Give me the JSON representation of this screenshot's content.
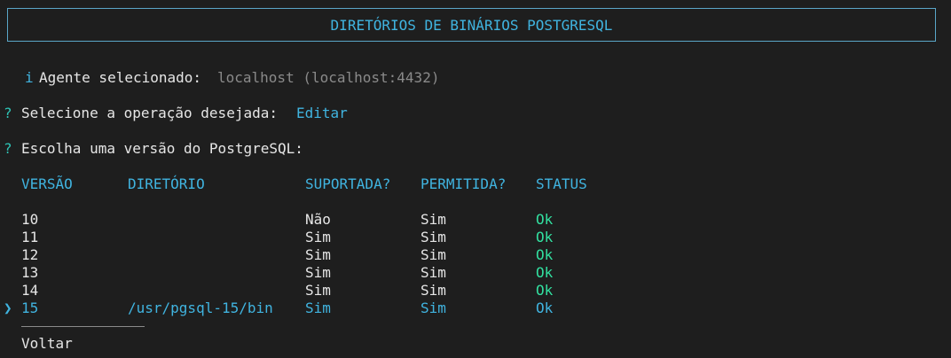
{
  "header": {
    "title": "DIRETÓRIOS DE BINÁRIOS POSTGRESQL"
  },
  "agent": {
    "icon": "i",
    "label": "Agente selecionado:",
    "value": "localhost (localhost:4432)"
  },
  "operation": {
    "prefix": "?",
    "label": "Selecione a operação desejada:",
    "value": "Editar"
  },
  "version_prompt": {
    "prefix": "?",
    "label": "Escolha uma versão do PostgreSQL:"
  },
  "table": {
    "columns": [
      "VERSÃO",
      "DIRETÓRIO",
      "SUPORTADA?",
      "PERMITIDA?",
      "STATUS"
    ],
    "rows": [
      {
        "version": "10",
        "directory": "",
        "supported": "Não",
        "allowed": "Sim",
        "status": "Ok"
      },
      {
        "version": "11",
        "directory": "",
        "supported": "Sim",
        "allowed": "Sim",
        "status": "Ok"
      },
      {
        "version": "12",
        "directory": "",
        "supported": "Sim",
        "allowed": "Sim",
        "status": "Ok"
      },
      {
        "version": "13",
        "directory": "",
        "supported": "Sim",
        "allowed": "Sim",
        "status": "Ok"
      },
      {
        "version": "14",
        "directory": "",
        "supported": "Sim",
        "allowed": "Sim",
        "status": "Ok"
      },
      {
        "version": "15",
        "directory": "/usr/pgsql-15/bin",
        "supported": "Sim",
        "allowed": "Sim",
        "status": "Ok"
      }
    ],
    "selected_index": 5,
    "cursor": "❯"
  },
  "back": {
    "label": "Voltar"
  },
  "colors": {
    "background": "#1e1e1e",
    "text": "#e6e6e6",
    "muted": "#8a8a8a",
    "accent": "#40b4e0",
    "prompt": "#2ec4b6",
    "ok": "#32e0a0",
    "border": "#5aa6c8"
  }
}
